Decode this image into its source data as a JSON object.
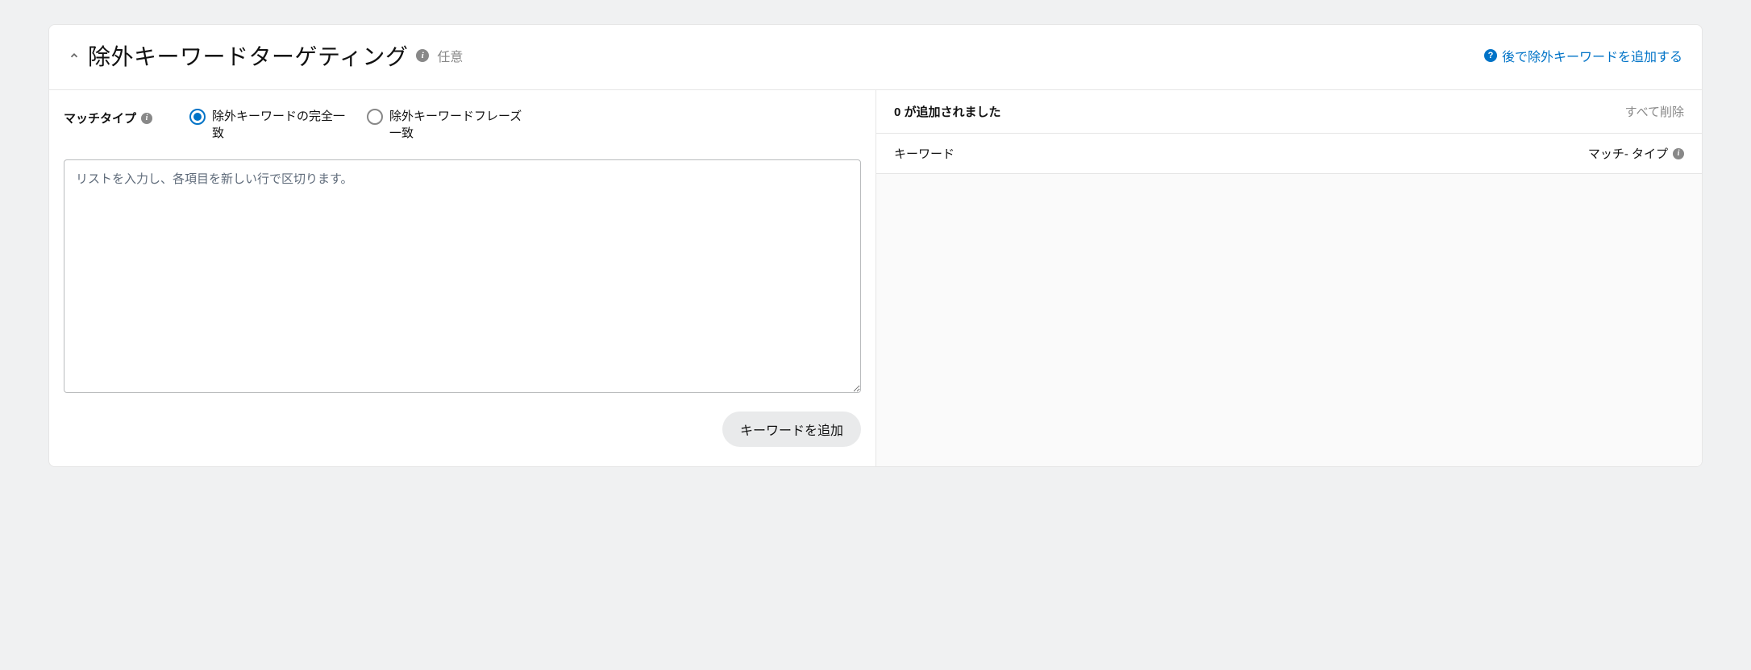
{
  "header": {
    "title": "除外キーワードターゲティング",
    "optional_label": "任意",
    "help_link": "後で除外キーワードを追加する"
  },
  "left": {
    "match_type_label": "マッチタイプ",
    "radio_exact": "除外キーワードの完全一致",
    "radio_phrase": "除外キーワードフレーズ一致",
    "selected": "exact",
    "textarea_placeholder": "リストを入力し、各項目を新しい行で区切ります。",
    "add_button": "キーワードを追加"
  },
  "right": {
    "added_count_label": "0 が追加されました",
    "delete_all": "すべて削除",
    "col_keyword": "キーワード",
    "col_match_type": "マッチ- タイプ"
  }
}
